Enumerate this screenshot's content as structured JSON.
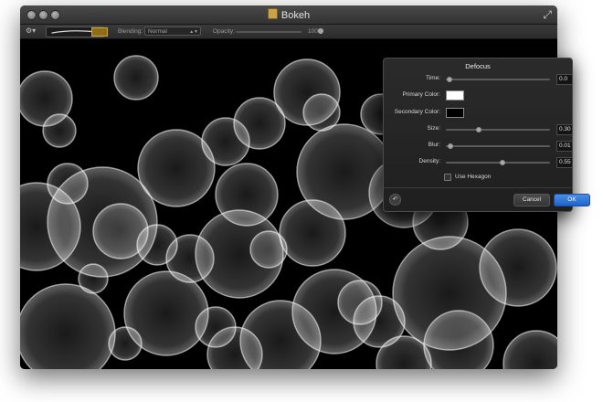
{
  "window": {
    "title": "Bokeh",
    "doc_icon": "bokeh-document-icon",
    "fullscreen_icon": "fullscreen-arrows-icon"
  },
  "toolbar": {
    "gear_icon": "gear-icon",
    "blending_label": "Blending:",
    "blending_value": "Normal",
    "opacity_label": "Opacity:",
    "opacity_value": "100%",
    "opacity_level": 1.0,
    "brush_color": "#8f6c18"
  },
  "dialog": {
    "title": "Defocus",
    "time": {
      "label": "Time:",
      "value": "0.0",
      "level": 0.0
    },
    "primary_color": {
      "label": "Primary Color:",
      "color": "#ffffff"
    },
    "secondary_color": {
      "label": "Secondary Color:",
      "color": "#000000"
    },
    "size": {
      "label": "Size:",
      "value": "0.30",
      "level": 0.3
    },
    "blur": {
      "label": "Blur:",
      "value": "0.01",
      "level": 0.01
    },
    "density": {
      "label": "Density:",
      "value": "0.55",
      "level": 0.55
    },
    "use_hexagon": {
      "label": "Use Hexagon",
      "checked": false
    },
    "cancel_label": "Cancel",
    "ok_label": "OK",
    "reset_icon": "reset-arrow-icon"
  },
  "colors": {
    "accent": "#2f74d8",
    "canvas_background": "#000000",
    "bokeh_light": "#ffffff"
  }
}
